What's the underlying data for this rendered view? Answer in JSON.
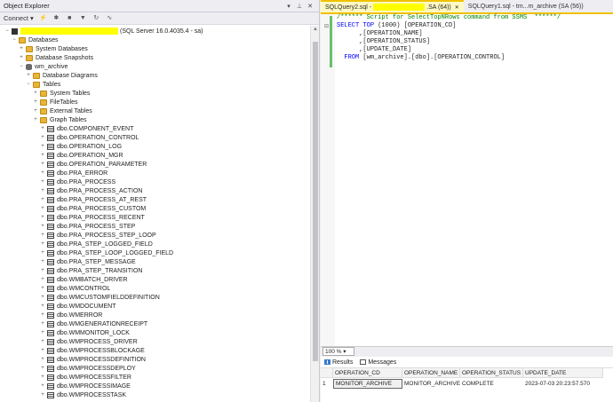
{
  "object_explorer": {
    "title": "Object Explorer",
    "connect_label": "Connect",
    "server_suffix": "(SQL Server 16.0.4035.4 - sa)",
    "nodes": [
      {
        "label": "Databases",
        "icon": "folder-icon",
        "expander": "−"
      },
      {
        "label": "System Databases",
        "icon": "folder-icon",
        "expander": "+"
      },
      {
        "label": "Database Snapshots",
        "icon": "folder-icon",
        "expander": "+"
      },
      {
        "label": "wm_archive",
        "icon": "database-icon",
        "expander": "−"
      },
      {
        "label": "Database Diagrams",
        "icon": "folder-icon",
        "expander": "+"
      },
      {
        "label": "Tables",
        "icon": "folder-icon",
        "expander": "−"
      },
      {
        "label": "System Tables",
        "icon": "folder-icon",
        "expander": "+"
      },
      {
        "label": "FileTables",
        "icon": "folder-icon",
        "expander": "+"
      },
      {
        "label": "External Tables",
        "icon": "folder-icon",
        "expander": "+"
      },
      {
        "label": "Graph Tables",
        "icon": "folder-icon",
        "expander": "+"
      }
    ],
    "tables": [
      "dbo.COMPONENT_EVENT",
      "dbo.OPERATION_CONTROL",
      "dbo.OPERATION_LOG",
      "dbo.OPERATION_MGR",
      "dbo.OPERATION_PARAMETER",
      "dbo.PRA_ERROR",
      "dbo.PRA_PROCESS",
      "dbo.PRA_PROCESS_ACTION",
      "dbo.PRA_PROCESS_AT_REST",
      "dbo.PRA_PROCESS_CUSTOM",
      "dbo.PRA_PROCESS_RECENT",
      "dbo.PRA_PROCESS_STEP",
      "dbo.PRA_PROCESS_STEP_LOOP",
      "dbo.PRA_STEP_LOGGED_FIELD",
      "dbo.PRA_STEP_LOOP_LOGGED_FIELD",
      "dbo.PRA_STEP_MESSAGE",
      "dbo.PRA_STEP_TRANSITION",
      "dbo.WMBATCH_DRIVER",
      "dbo.WMCONTROL",
      "dbo.WMCUSTOMFIELDDEFINITION",
      "dbo.WMDOCUMENT",
      "dbo.WMERROR",
      "dbo.WMGENERATIONRECEIPT",
      "dbo.WMMONITOR_LOCK",
      "dbo.WMPROCESS_DRIVER",
      "dbo.WMPROCESSBLOCKAGE",
      "dbo.WMPROCESSDEFINITION",
      "dbo.WMPROCESSDEPLOY",
      "dbo.WMPROCESSFILTER",
      "dbo.WMPROCESSIMAGE",
      "dbo.WMPROCESSTASK"
    ]
  },
  "editor": {
    "tabs": [
      {
        "label_start": "SQLQuery2.sql -",
        "label_end": ".SA (64))",
        "active": true
      },
      {
        "label_start": "SQLQuery1.sql - tm...m_archive (SA (56))",
        "label_end": "",
        "active": false
      }
    ],
    "code": {
      "comment": "/****** Script for SelectTopNRows command from SSMS  ******/",
      "select": "SELECT",
      "top": "TOP",
      "top_value": "(1000) [OPERATION_CD]",
      "col2": ",[OPERATION_NAME]",
      "col3": ",[OPERATION_STATUS]",
      "col4": ",[UPDATE_DATE]",
      "from": "FROM",
      "table": "[wm_archive].[dbo].[OPERATION_CONTROL]"
    },
    "zoom": "100 %",
    "result_tabs": [
      "Results",
      "Messages"
    ],
    "grid": {
      "columns": [
        "OPERATION_CD",
        "OPERATION_NAME",
        "OPERATION_STATUS",
        "UPDATE_DATE"
      ],
      "rows": [
        {
          "num": "1",
          "cells": [
            "MONITOR_ARCHIVE",
            "MONITOR_ARCHIVE",
            "COMPLETE",
            "2023-07-03 20:23:57.570"
          ]
        }
      ]
    }
  }
}
